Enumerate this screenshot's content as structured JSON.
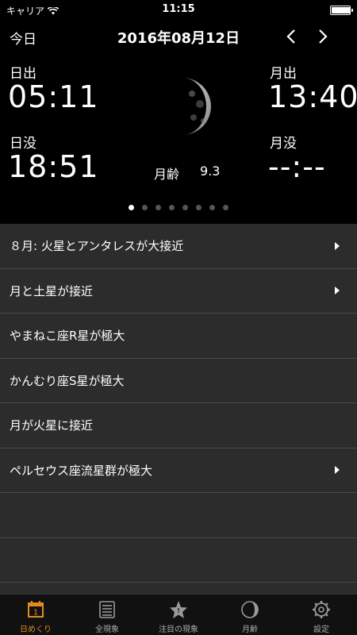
{
  "status": {
    "carrier": "キャリア",
    "time": "11:15"
  },
  "nav": {
    "today": "今日",
    "date": "2016年08月12日"
  },
  "sun": {
    "rise_label": "日出",
    "rise": "05:11",
    "set_label": "日没",
    "set": "18:51"
  },
  "moon": {
    "rise_label": "月出",
    "rise": "13:40",
    "set_label": "月没",
    "set": "--:--",
    "age_label": "月齢",
    "age": "9.3"
  },
  "pager": {
    "count": 8,
    "active": 0
  },
  "events": [
    {
      "text": "８月: 火星とアンタレスが大接近",
      "has_detail": true
    },
    {
      "text": "月と土星が接近",
      "has_detail": true
    },
    {
      "text": "やまねこ座R星が極大",
      "has_detail": false
    },
    {
      "text": "かんむり座S星が極大",
      "has_detail": false
    },
    {
      "text": "月が火星に接近",
      "has_detail": false
    },
    {
      "text": "ペルセウス座流星群が極大",
      "has_detail": true
    },
    {
      "text": "",
      "has_detail": false
    },
    {
      "text": "",
      "has_detail": false
    }
  ],
  "tabs": [
    {
      "label": "日めくり",
      "icon": "calendar-icon",
      "active": true
    },
    {
      "label": "全現象",
      "icon": "list-icon",
      "active": false
    },
    {
      "label": "注目の現象",
      "icon": "star-icon",
      "active": false
    },
    {
      "label": "月齢",
      "icon": "moon-phase-icon",
      "active": false
    },
    {
      "label": "設定",
      "icon": "gear-icon",
      "active": false
    }
  ],
  "colors": {
    "accent": "#e58a1f",
    "list_bg": "#2c2c2c",
    "separator": "#4a4a4a"
  }
}
